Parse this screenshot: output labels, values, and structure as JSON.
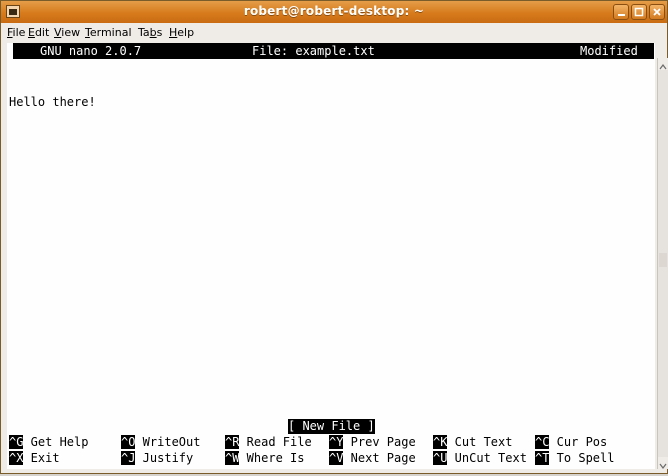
{
  "window": {
    "title": "robert@robert-desktop: ~"
  },
  "menubar": {
    "items": [
      {
        "first": "F",
        "rest": "ile"
      },
      {
        "first": "E",
        "rest": "dit"
      },
      {
        "first": "V",
        "rest": "iew"
      },
      {
        "first": "T",
        "rest": "erminal"
      },
      {
        "pre": "Ta",
        "first": "b",
        "rest": "s"
      },
      {
        "first": "H",
        "rest": "elp"
      }
    ]
  },
  "nano": {
    "version": "GNU nano 2.0.7",
    "file": "File: example.txt",
    "state": "Modified",
    "content": "Hello there!",
    "status": "[ New File ]",
    "shortcuts_row1": [
      {
        "key": "^G",
        "label": " Get Help"
      },
      {
        "key": "^O",
        "label": " WriteOut"
      },
      {
        "key": "^R",
        "label": " Read File"
      },
      {
        "key": "^Y",
        "label": " Prev Page"
      },
      {
        "key": "^K",
        "label": " Cut Text"
      },
      {
        "key": "^C",
        "label": " Cur Pos"
      }
    ],
    "shortcuts_row2": [
      {
        "key": "^X",
        "label": " Exit"
      },
      {
        "key": "^J",
        "label": " Justify"
      },
      {
        "key": "^W",
        "label": " Where Is"
      },
      {
        "key": "^V",
        "label": " Next Page"
      },
      {
        "key": "^U",
        "label": " UnCut Text"
      },
      {
        "key": "^T",
        "label": " To Spell"
      }
    ]
  },
  "colors": {
    "titlebar": "#d77b1d",
    "terminal_bg": "#fefefe",
    "inverse": "#000000"
  }
}
